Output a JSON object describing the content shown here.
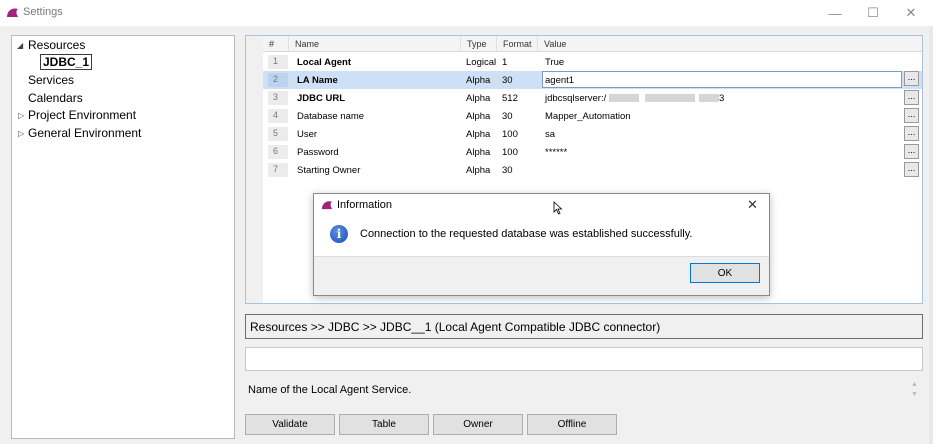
{
  "window": {
    "title": "Settings",
    "minimize_glyph": "—",
    "maximize_glyph": "☐",
    "close_glyph": "✕"
  },
  "tree": {
    "items": [
      {
        "label": "Resources",
        "expanded": true
      },
      {
        "label": "JDBC_1",
        "selected": true
      },
      {
        "label": "Services"
      },
      {
        "label": "Calendars"
      },
      {
        "label": "Project Environment",
        "expanded": false
      },
      {
        "label": "General Environment",
        "expanded": false
      }
    ]
  },
  "grid": {
    "columns": [
      "#",
      "Name",
      "Type",
      "Format",
      "Value"
    ],
    "rows": [
      {
        "num": "1",
        "name": "Local Agent",
        "type": "Logical",
        "format": "1",
        "value": "True",
        "bold": true
      },
      {
        "num": "2",
        "name": "LA Name",
        "type": "Alpha",
        "format": "30",
        "value": "agent1",
        "bold": true
      },
      {
        "num": "3",
        "name": "JDBC URL",
        "type": "Alpha",
        "format": "512",
        "value": "jdbcsqlserver:/",
        "value_suffix": "3",
        "bold": true
      },
      {
        "num": "4",
        "name": "Database name",
        "type": "Alpha",
        "format": "30",
        "value": "Mapper_Automation"
      },
      {
        "num": "5",
        "name": "User",
        "type": "Alpha",
        "format": "100",
        "value": "sa"
      },
      {
        "num": "6",
        "name": "Password",
        "type": "Alpha",
        "format": "100",
        "value": "******"
      },
      {
        "num": "7",
        "name": "Starting Owner",
        "type": "Alpha",
        "format": "30",
        "value": ""
      }
    ],
    "ellipsis_label": "..."
  },
  "breadcrumb": "Resources >> JDBC >> JDBC__1 (Local Agent Compatible JDBC connector)",
  "description": "Name of the Local Agent Service.",
  "buttons": {
    "validate": "Validate",
    "table": "Table",
    "owner": "Owner",
    "offline": "Offline"
  },
  "dialog": {
    "title": "Information",
    "message": "Connection to the requested database was established successfully.",
    "ok": "OK",
    "close_glyph": "✕",
    "info_glyph": "i"
  },
  "colors": {
    "brand": "#a2247a",
    "selection": "#cde0f6",
    "ok_border": "#0078d7"
  }
}
